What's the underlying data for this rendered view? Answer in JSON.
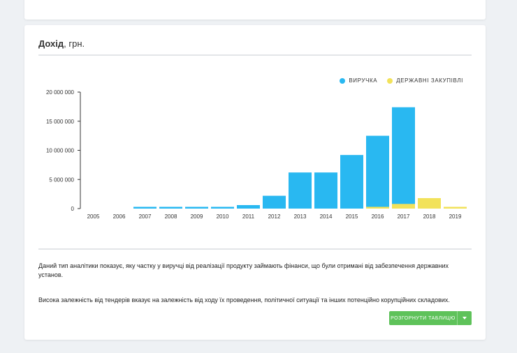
{
  "card": {
    "title": "Дохід",
    "title_unit": ", грн."
  },
  "legend": [
    {
      "label": "ВИРУЧКА",
      "color": "#29b8f1"
    },
    {
      "label": "ДЕРЖАВНІ ЗАКУПІВЛІ",
      "color": "#f2e25a"
    }
  ],
  "chart_data": {
    "type": "bar",
    "categories": [
      "2005",
      "2006",
      "2007",
      "2008",
      "2009",
      "2010",
      "2011",
      "2012",
      "2013",
      "2014",
      "2015",
      "2016",
      "2017",
      "2018",
      "2019"
    ],
    "series": [
      {
        "name": "ВИРУЧКА",
        "color": "#29b8f1",
        "values": [
          0,
          0,
          300000,
          300000,
          300000,
          300000,
          600000,
          2200000,
          6200000,
          6200000,
          9200000,
          12500000,
          17400000,
          0,
          0
        ]
      },
      {
        "name": "ДЕРЖАВНІ ЗАКУПІВЛІ",
        "color": "#f2e25a",
        "values": [
          0,
          0,
          0,
          0,
          0,
          0,
          0,
          0,
          0,
          0,
          0,
          300000,
          800000,
          1800000,
          300000
        ]
      }
    ],
    "y_ticks": [
      0,
      5000000,
      10000000,
      15000000,
      20000000
    ],
    "y_tick_labels": [
      "0",
      "5 000 000",
      "10 000 000",
      "15 000 000",
      "20 000 000"
    ],
    "ylim": [
      0,
      20000000
    ],
    "grid": false,
    "legend_position": "top-right"
  },
  "description": {
    "paragraph1": "Даний тип аналітики показує, яку частку у виручці від реалізації продукту займають фінанси, що були отримані від забезпечення державних установ.",
    "paragraph2": "Висока залежність від тендерів вказує на залежність від ходу їх проведення, політичної ситуації та інших потенційно корупційних складових."
  },
  "button": {
    "label": "РОЗГОРНУТИ ТАБЛИЦЮ"
  }
}
